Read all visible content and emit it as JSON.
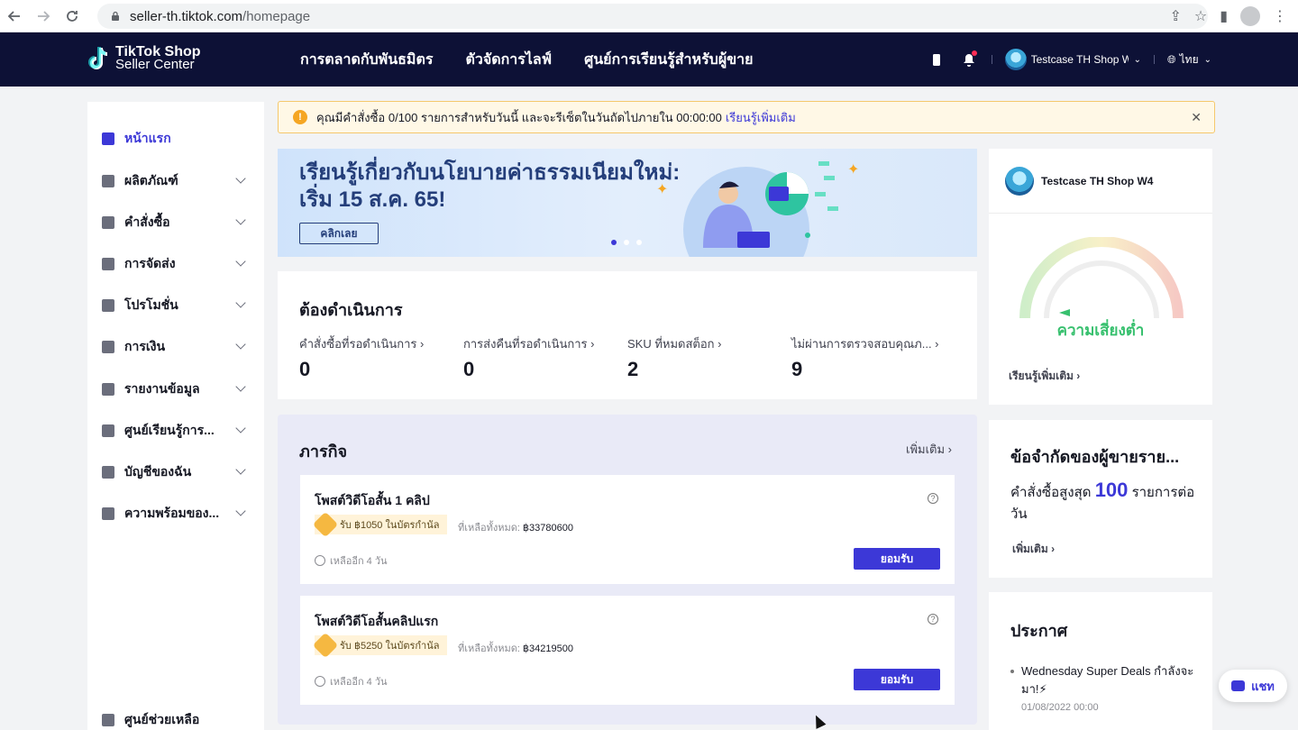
{
  "browser": {
    "domain": "seller-th.tiktok.com",
    "path": "/homepage"
  },
  "header": {
    "logo_line1": "TikTok Shop",
    "logo_line2": "Seller Center",
    "nav": [
      "การตลาดกับพันธมิตร",
      "ตัวจัดการไลฟ์",
      "ศูนย์การเรียนรู้สำหรับผู้ขาย"
    ],
    "shop_name": "Testcase TH Shop W4",
    "language": "ไทย"
  },
  "sidebar": {
    "items": [
      {
        "label": "หน้าแรก",
        "icon": "home-icon",
        "active": true
      },
      {
        "label": "ผลิตภัณฑ์",
        "icon": "product-icon"
      },
      {
        "label": "คำสั่งซื้อ",
        "icon": "order-icon"
      },
      {
        "label": "การจัดส่ง",
        "icon": "truck-icon"
      },
      {
        "label": "โปรโมชั่น",
        "icon": "megaphone-icon"
      },
      {
        "label": "การเงิน",
        "icon": "card-icon"
      },
      {
        "label": "รายงานข้อมูล",
        "icon": "chart-icon"
      },
      {
        "label": "ศูนย์เรียนรู้การ...",
        "icon": "medal-icon"
      },
      {
        "label": "บัญชีของฉัน",
        "icon": "user-icon"
      },
      {
        "label": "ความพร้อมของ...",
        "icon": "trophy-icon"
      }
    ],
    "help_center": "ศูนย์ช่วยเหลือ"
  },
  "alert": {
    "text": "คุณมีคำสั่งซื้อ 0/100 รายการสำหรับวันนี้ และจะรีเซ็ตในวันถัดไปภายใน 00:00:00",
    "link": "เรียนรู้เพิ่มเติม"
  },
  "banner": {
    "line1": "เรียนรู้เกี่ยวกับนโยบายค่าธรรมเนียมใหม่:",
    "line2": "เริ่ม 15 ส.ค. 65!",
    "button": "คลิกเลย"
  },
  "todo": {
    "title": "ต้องดำเนินการ",
    "items": [
      {
        "label": "คำสั่งซื้อที่รอดำเนินการ",
        "value": "0"
      },
      {
        "label": "การส่งคืนที่รอดำเนินการ",
        "value": "0"
      },
      {
        "label": "SKU ที่หมดสต็อก",
        "value": "2"
      },
      {
        "label": "ไม่ผ่านการตรวจสอบคุณภ...",
        "value": "9"
      }
    ]
  },
  "missions": {
    "title": "ภารกิจ",
    "more": "เพิ่มเติม",
    "list": [
      {
        "title": "โพสต์วิดีโอสั้น 1 คลิป",
        "reward": "รับ ฿1050 ในบัตรกำนัล",
        "remaining_label": "ที่เหลือทั้งหมด:",
        "remaining_value": "฿33780600",
        "days": "เหลืออีก 4 วัน",
        "button": "ยอมรับ"
      },
      {
        "title": "โพสต์วิดีโอสั้นคลิปแรก",
        "reward": "รับ ฿5250 ในบัตรกำนัล",
        "remaining_label": "ที่เหลือทั้งหมด:",
        "remaining_value": "฿34219500",
        "days": "เหลืออีก 4 วัน",
        "button": "ยอมรับ"
      }
    ]
  },
  "health": {
    "shop_name": "Testcase TH Shop W4",
    "risk": "ความเสี่ยงต่ำ",
    "learn_more": "เรียนรู้เพิ่มเติม"
  },
  "limit": {
    "title": "ข้อจำกัดของผู้ขายราย...",
    "prefix": "คำสั่งซื้อสูงสุด",
    "value": "100",
    "suffix": "รายการต่อวัน",
    "more": "เพิ่มเติม"
  },
  "news": {
    "title": "ประกาศ",
    "item": "Wednesday Super Deals กำลังจะมา!⚡",
    "date": "01/08/2022 00:00"
  },
  "chat": {
    "label": "แชท"
  },
  "colors": {
    "brand": "#3c38d7",
    "header_bg": "#0d1136",
    "risk_low": "#37c06e",
    "alert_bg": "#fff8e6"
  }
}
